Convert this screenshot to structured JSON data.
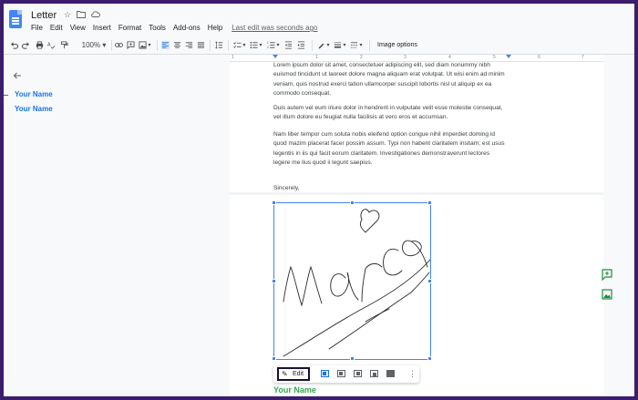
{
  "app": {
    "title": "Letter",
    "menu": [
      "File",
      "Edit",
      "View",
      "Insert",
      "Format",
      "Tools",
      "Add-ons",
      "Help"
    ],
    "last_edit": "Last edit was seconds ago",
    "icons": [
      "star-icon",
      "move-to-folder-icon",
      "cloud-status-icon"
    ]
  },
  "toolbar": {
    "zoom": "100%",
    "image_options": "Image options",
    "icons": [
      "undo-icon",
      "redo-icon",
      "print-icon",
      "spellcheck-icon",
      "paint-format-icon",
      "link-icon",
      "comment-icon",
      "insert-image-icon",
      "align-left-icon",
      "align-center-icon",
      "align-right-icon",
      "justify-icon",
      "line-spacing-icon",
      "checklist-icon",
      "bulleted-list-icon",
      "numbered-list-icon",
      "decrease-indent-icon",
      "increase-indent-icon",
      "border-color-icon",
      "border-weight-icon",
      "border-dash-icon"
    ]
  },
  "ruler": {
    "ticks": [
      "1",
      "1",
      "2",
      "3",
      "4",
      "5",
      "6",
      "7"
    ]
  },
  "outline": {
    "items": [
      "Your Name",
      "Your Name"
    ]
  },
  "document": {
    "paragraphs": [
      "Lorem ipsum dolor sit amet, consectetuer adipiscing elit, sed diam nonummy nibh euismod tincidunt ut laoreet dolore magna aliquam erat volutpat. Ut wisi enim ad minim veniam, quis nostrud exerci tation ullamcorper suscipit lobortis nisl ut aliquip ex ea commodo consequat.",
      "Duis autem vel eum iriure dolor in hendrerit in vulputate velit esse molestie consequat, vel illum dolore eu feugiat nulla facilisis at vero eros et accumsan.",
      "Nam liber tempor cum soluta nobis eleifend option congue nihil imperdiet doming id quod mazim placerat facer possim assum. Typi non habent claritatem insitam; est usus legentis in iis qui facit eorum claritatem. Investigationes demonstraverunt lectores legere me lius quod ii legunt saepius."
    ],
    "closing": "Sincerely,",
    "signature_name": "Your Name"
  },
  "image_toolbar": {
    "edit_label": "Edit",
    "icons": [
      "pencil-icon",
      "in-line-icon",
      "wrap-text-icon",
      "break-text-icon",
      "behind-text-icon",
      "in-front-of-text-icon",
      "more-options-icon"
    ]
  },
  "side_panel": {
    "icons": [
      "add-comment-icon",
      "suggest-image-icon"
    ]
  },
  "colors": {
    "accent": "#1a73e8",
    "heading_green": "#34a853",
    "frame": "#3b1d6e"
  }
}
